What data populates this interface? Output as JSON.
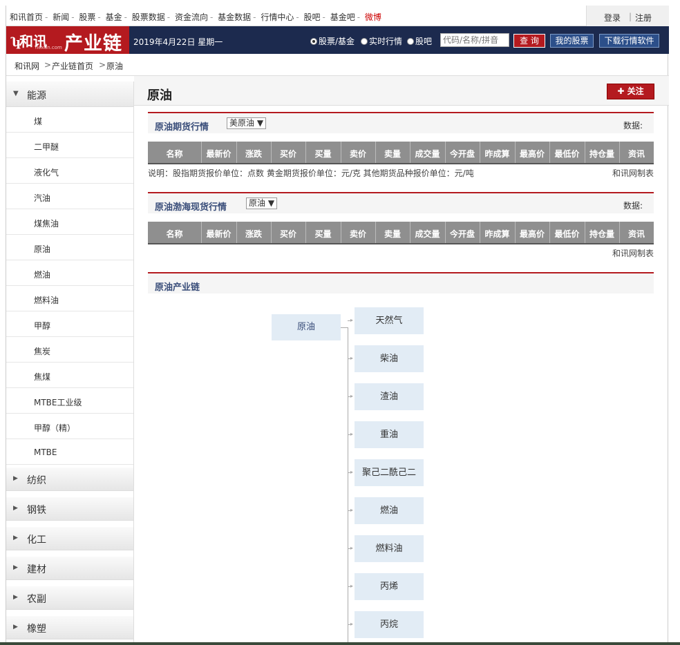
{
  "topnav": {
    "links": [
      "和讯首页",
      "新闻",
      "股票",
      "基金",
      "股票数据",
      "资金流向",
      "基金数据",
      "行情中心",
      "股吧",
      "基金吧",
      "微博"
    ],
    "login": "登录",
    "register": "注册"
  },
  "banner": {
    "logo_text": "和讯",
    "logo_domain": "hexun.com",
    "logo_title": "产业链",
    "date": "2019年4月22日 星期一",
    "radios": [
      {
        "label": "股票/基金",
        "selected": true
      },
      {
        "label": "实时行情",
        "selected": false
      },
      {
        "label": "股吧",
        "selected": false
      }
    ],
    "search_placeholder": "代码/名称/拼音",
    "query_button": "查 询",
    "my_stocks": "我的股票",
    "download": "下载行情软件"
  },
  "breadcrumb": [
    "和讯网",
    "产业链首页",
    "原油"
  ],
  "sidebar": {
    "expanded": {
      "label": "能源",
      "items": [
        "煤",
        "二甲醚",
        "液化气",
        "汽油",
        "煤焦油",
        "原油",
        "燃油",
        "燃料油",
        "甲醇",
        "焦炭",
        "焦煤",
        "MTBE工业级",
        "甲醇（精）",
        "MTBE"
      ]
    },
    "collapsed": [
      "纺织",
      "钢铁",
      "化工",
      "建材",
      "农副",
      "橡塑"
    ]
  },
  "main": {
    "title": "原油",
    "follow_button": "关注",
    "futures": {
      "title": "原油期货行情",
      "select": "美原油",
      "data_label": "数据:",
      "columns": [
        "名称",
        "最新价",
        "涨跌",
        "买价",
        "买量",
        "卖价",
        "卖量",
        "成交量",
        "今开盘",
        "昨成算",
        "最高价",
        "最低价",
        "持仓量",
        "资讯"
      ],
      "note": "说明：股指期货报价单位：点数 黄金期货报价单位：元/克 其他期货品种报价单位：元/吨",
      "credit": "和讯网制表"
    },
    "spot": {
      "title": "原油渤海现货行情",
      "select": "原油",
      "data_label": "数据:",
      "columns": [
        "名称",
        "最新价",
        "涨跌",
        "买价",
        "买量",
        "卖价",
        "卖量",
        "成交量",
        "今开盘",
        "昨成算",
        "最高价",
        "最低价",
        "持仓量",
        "资讯"
      ],
      "credit": "和讯网制表"
    },
    "chain": {
      "title": "原油产业链",
      "root": "原油",
      "children": [
        "天然气",
        "柴油",
        "渣油",
        "重油",
        "聚己二酰己二",
        "燃油",
        "燃料油",
        "丙烯",
        "丙烷"
      ]
    }
  },
  "colors": {
    "brand_red": "#b41a1f",
    "banner_navy": "#1c2a4e",
    "table_header_gray": "#8f8f8f",
    "chain_node_bg": "#e2ecf5"
  }
}
